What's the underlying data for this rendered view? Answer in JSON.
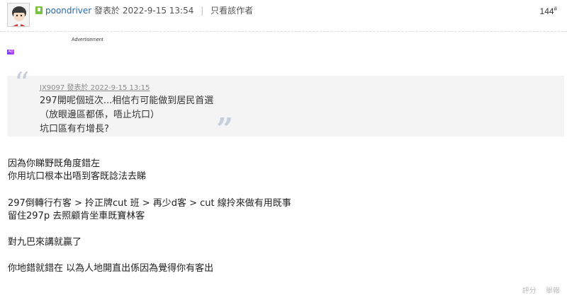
{
  "post": {
    "author": "poondriver",
    "posted_label": "發表於 2022-9-15 13:54",
    "only_author": "只看該作者",
    "floor": "144",
    "floor_mark": "#"
  },
  "ad": {
    "label": "Advertisement",
    "chip": "AD"
  },
  "quote": {
    "meta": "JX9097 發表於 2022-9-15 13:15",
    "lines": [
      "297開呢個班次...相信冇可能做到居民首選",
      "（放眼邊區都係，唔止坑口）",
      "坑口區有冇增長?"
    ]
  },
  "body": {
    "lines": [
      "因為你睇野既角度錯左",
      "你用坑口根本出唔到客既諗法去睇",
      "297倒轉行冇客 > 拎正牌cut 班 > 再少d客 > cut 線拎來做有用既事",
      "留住297p 去照顧肯坐車既寶林客",
      "對九巴來講就贏了",
      "你地錯就錯在 以為人地開直出係因為覺得你有客出"
    ]
  },
  "actions": {
    "rate": "評分",
    "report": "舉報"
  },
  "colors": {
    "author_link": "#2a6aa8",
    "quote_bg": "#f4f4f4",
    "online_badge": "#7ac143"
  }
}
